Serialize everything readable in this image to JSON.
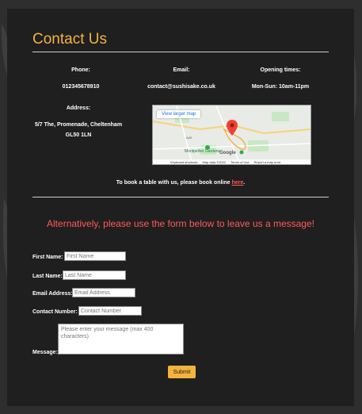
{
  "page": {
    "title": "Contact Us"
  },
  "contact": {
    "phone_label": "Phone:",
    "phone_value": "012345678910",
    "email_label": "Email:",
    "email_value": "contact@sushisake.co.uk",
    "hours_label": "Opening times:",
    "hours_value": "Mon-Sun: 10am-11pm",
    "address_label": "Address:",
    "address_line1": "5/7 The, Promenade, Cheltenham",
    "address_line2": "GL50 1LN"
  },
  "map": {
    "view_larger": "View larger map",
    "place_label": "Montpellier Gardens",
    "road_label": "A40",
    "provider": "Google",
    "keyboard": "Keyboard shortcuts",
    "map_data": "Map data ©2022",
    "terms": "Terms of Use",
    "report": "Report a map error"
  },
  "booking": {
    "text": "To book a table with us, please book online ",
    "link": "here",
    "end": "."
  },
  "form": {
    "intro": "Alternatively, please use the form below to leave us a message!",
    "first_name_label": "First Name:",
    "first_name_placeholder": "First Name",
    "last_name_label": "Last Name:",
    "last_name_placeholder": "Last Name",
    "email_label": "Email Address:",
    "email_placeholder": "Email Address",
    "contact_label": "Contact Number:",
    "contact_placeholder": "Contact Number",
    "message_label": "Message:",
    "message_placeholder": "Please enter your message (max 400 characters)",
    "submit": "Submit"
  },
  "colors": {
    "accent": "#f3b33d",
    "highlight": "#ff5a5a",
    "panel": "#1f1f1f",
    "background": "#2e2e2e"
  }
}
